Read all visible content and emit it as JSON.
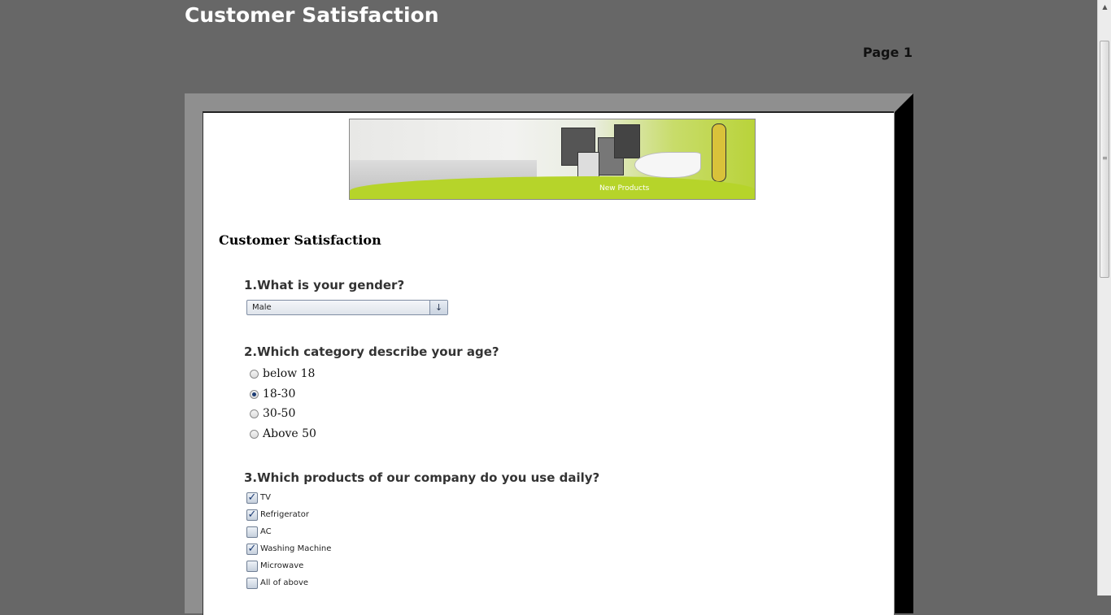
{
  "header": {
    "title": "Customer Satisfaction",
    "page_label": "Page 1"
  },
  "banner": {
    "caption": "New Products"
  },
  "form": {
    "title": "Customer Satisfaction",
    "q1": {
      "text": "1.What is your gender?",
      "selected": "Male"
    },
    "q2": {
      "text": "2.Which category describe your age?",
      "options": [
        "below 18",
        "18-30",
        "30-50",
        "Above 50"
      ],
      "selected_index": 1
    },
    "q3": {
      "text": "3.Which products of our company do you use daily?",
      "options": [
        "TV",
        "Refrigerator",
        "AC",
        "Washing Machine",
        "Microwave",
        "All of above"
      ],
      "checked": [
        true,
        true,
        false,
        true,
        false,
        false
      ]
    }
  },
  "icons": {
    "dropdown": "chevron-down-icon",
    "scroll": "scrollbar"
  }
}
